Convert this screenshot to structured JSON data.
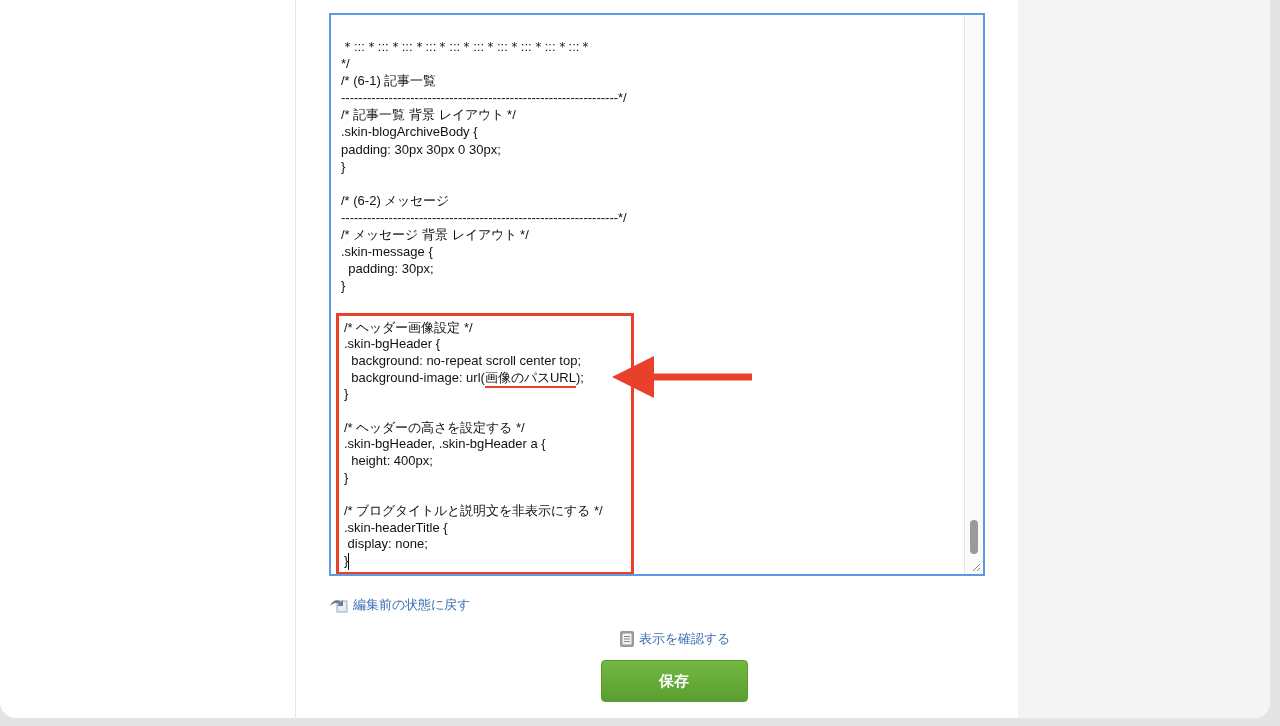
{
  "editor": {
    "lines": [
      {
        "kind": "text",
        "text": "＊:::＊:::＊:::＊:::＊:::＊:::＊:::＊:::＊:::＊:::＊"
      },
      {
        "kind": "text",
        "text": "*/"
      },
      {
        "kind": "text",
        "text": "/* (6-1) 記事一覧"
      },
      {
        "kind": "text",
        "text": "----------------------------------------------------------------*/"
      },
      {
        "kind": "text",
        "text": "/* 記事一覧 背景 レイアウト */"
      },
      {
        "kind": "text",
        "text": ".skin-blogArchiveBody {"
      },
      {
        "kind": "text",
        "text": "padding: 30px 30px 0 30px;"
      },
      {
        "kind": "text",
        "text": "}"
      },
      {
        "kind": "blank"
      },
      {
        "kind": "text",
        "text": "/* (6-2) メッセージ"
      },
      {
        "kind": "text",
        "text": "----------------------------------------------------------------*/"
      },
      {
        "kind": "text",
        "text": "/* メッセージ 背景 レイアウト */"
      },
      {
        "kind": "text",
        "text": ".skin-message {"
      },
      {
        "kind": "text",
        "text": "  padding: 30px;"
      },
      {
        "kind": "text",
        "text": "}"
      },
      {
        "kind": "blank"
      }
    ],
    "highlighted_lines": [
      {
        "kind": "text",
        "text": "/* ヘッダー画像設定 */"
      },
      {
        "kind": "text",
        "text": ".skin-bgHeader {"
      },
      {
        "kind": "text",
        "text": "  background: no-repeat scroll center top;"
      },
      {
        "kind": "parts",
        "parts": [
          {
            "text": "  background-image: url(",
            "underlined": false
          },
          {
            "text": "画像のパスURL",
            "underlined": true
          },
          {
            "text": ");",
            "underlined": false
          }
        ]
      },
      {
        "kind": "text",
        "text": "}"
      },
      {
        "kind": "blank"
      },
      {
        "kind": "text",
        "text": "/* ヘッダーの高さを設定する */"
      },
      {
        "kind": "text",
        "text": ".skin-bgHeader, .skin-bgHeader a {"
      },
      {
        "kind": "text",
        "text": "  height: 400px;"
      },
      {
        "kind": "text",
        "text": "}"
      },
      {
        "kind": "blank"
      },
      {
        "kind": "text",
        "text": "/* ブログタイトルと説明文を非表示にする */"
      },
      {
        "kind": "text",
        "text": ".skin-headerTitle {"
      },
      {
        "kind": "text",
        "text": " display: none;"
      },
      {
        "kind": "text",
        "text": "}",
        "cursor": true
      }
    ]
  },
  "revert_link": "編集前の状態に戻す",
  "preview_link": "表示を確認する",
  "save_button": "保存"
}
